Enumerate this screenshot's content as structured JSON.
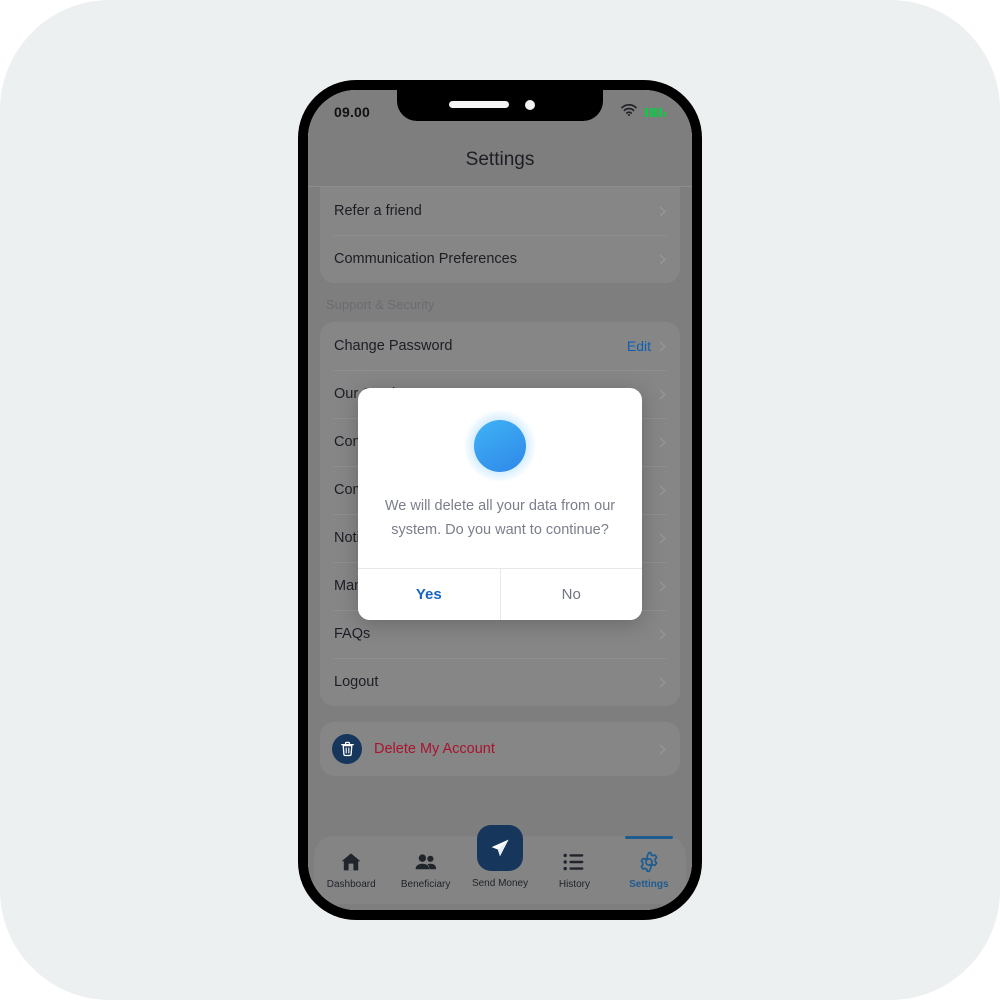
{
  "status_bar": {
    "time": "09.00",
    "wifi_icon": "wifi-icon",
    "battery_icon": "battery-icon"
  },
  "header": {
    "title": "Settings"
  },
  "settings_list": {
    "top_group": [
      {
        "label": "Refer a friend",
        "action": "",
        "chevron": true
      },
      {
        "label": "Communication Preferences",
        "action": "",
        "chevron": true
      }
    ],
    "section_title": "Support & Security",
    "support_group": [
      {
        "label": "Change Password",
        "action": "Edit",
        "chevron": true
      },
      {
        "label": "Our Services",
        "action": "",
        "chevron": true
      },
      {
        "label": "Contact Us",
        "action": "",
        "chevron": true
      },
      {
        "label": "Compliance",
        "action": "",
        "chevron": true
      },
      {
        "label": "Notifications",
        "action": "",
        "chevron": true
      },
      {
        "label": "Manage Devices",
        "action": "",
        "chevron": true
      },
      {
        "label": "FAQs",
        "action": "",
        "chevron": true
      },
      {
        "label": "Logout",
        "action": "",
        "chevron": true
      }
    ],
    "delete_row": {
      "label": "Delete My Account",
      "icon": "trash-icon",
      "chevron": true
    }
  },
  "tab_bar": {
    "items": [
      {
        "label": "Dashboard",
        "icon": "home-icon",
        "active": false
      },
      {
        "label": "Beneficiary",
        "icon": "people-icon",
        "active": false
      },
      {
        "label": "Send Money",
        "icon": "paper-plane-icon",
        "active": false
      },
      {
        "label": "History",
        "icon": "list-icon",
        "active": false
      },
      {
        "label": "Settings",
        "icon": "gear-icon",
        "active": true
      }
    ]
  },
  "modal": {
    "icon": "info-icon",
    "message": "We will delete all your data from our system. Do you want to continue?",
    "confirm_label": "Yes",
    "cancel_label": "No"
  },
  "colors": {
    "accent_blue": "#1665c0",
    "navy": "#16365c",
    "danger_red": "#a8142e",
    "page_bg": "#ecf0f1",
    "active_tab": "#1e5b8f"
  }
}
